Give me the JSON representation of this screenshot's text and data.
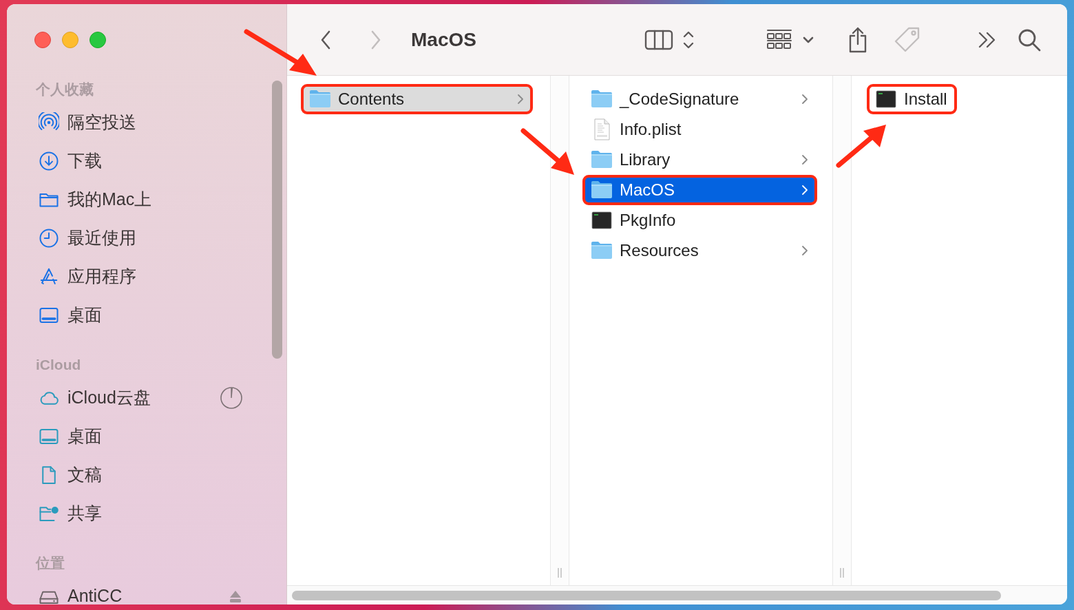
{
  "window": {
    "title": "MacOS"
  },
  "toolbar": {
    "navigation": [
      {
        "kind": "back",
        "disabled": false
      },
      {
        "kind": "forward",
        "disabled": true
      }
    ],
    "actions": [
      {
        "kind": "view-columns",
        "disabled": false
      },
      {
        "kind": "group",
        "disabled": false
      },
      {
        "kind": "share",
        "disabled": false
      },
      {
        "kind": "tags",
        "disabled": true
      },
      {
        "kind": "more",
        "disabled": false
      },
      {
        "kind": "search",
        "disabled": false
      }
    ]
  },
  "sidebar": {
    "sections": [
      {
        "title": "个人收藏",
        "color": "#1a72e6",
        "items": [
          {
            "label": "隔空投送",
            "kind": "airdrop",
            "selected": false
          },
          {
            "label": "下载",
            "kind": "download",
            "selected": false
          },
          {
            "label": "我的Mac上",
            "kind": "folder",
            "selected": false
          },
          {
            "label": "最近使用",
            "kind": "clock",
            "selected": false
          },
          {
            "label": "应用程序",
            "kind": "apps",
            "selected": false
          },
          {
            "label": "桌面",
            "kind": "desktop",
            "selected": false
          }
        ]
      },
      {
        "title": "iCloud",
        "color": "#2b9bbd",
        "items": [
          {
            "label": "iCloud云盘",
            "kind": "cloud",
            "selected": false,
            "syncing": true
          },
          {
            "label": "桌面",
            "kind": "desktop",
            "selected": false
          },
          {
            "label": "文稿",
            "kind": "document",
            "selected": false
          },
          {
            "label": "共享",
            "kind": "shared",
            "selected": false
          }
        ]
      },
      {
        "title": "位置",
        "color": "#6f6468",
        "items": [
          {
            "label": "AntiCC",
            "kind": "drive",
            "selected": false,
            "ejectable": true
          }
        ]
      }
    ]
  },
  "columns": [
    {
      "focused": false,
      "items": [
        {
          "name": "Contents",
          "kind": "folder",
          "selected": true,
          "annotated": true
        }
      ]
    },
    {
      "focused": true,
      "items": [
        {
          "name": "_CodeSignature",
          "kind": "folder",
          "selected": false,
          "annotated": false
        },
        {
          "name": "Info.plist",
          "kind": "plist",
          "selected": false,
          "annotated": false
        },
        {
          "name": "Library",
          "kind": "folder",
          "selected": false,
          "annotated": false
        },
        {
          "name": "MacOS",
          "kind": "folder",
          "selected": true,
          "annotated": true
        },
        {
          "name": "PkgInfo",
          "kind": "exec",
          "selected": false,
          "annotated": false
        },
        {
          "name": "Resources",
          "kind": "folder",
          "selected": false,
          "annotated": false
        }
      ]
    },
    {
      "items": [
        {
          "name": "Install",
          "kind": "exec",
          "selected": false,
          "annotated": true
        }
      ]
    }
  ]
}
